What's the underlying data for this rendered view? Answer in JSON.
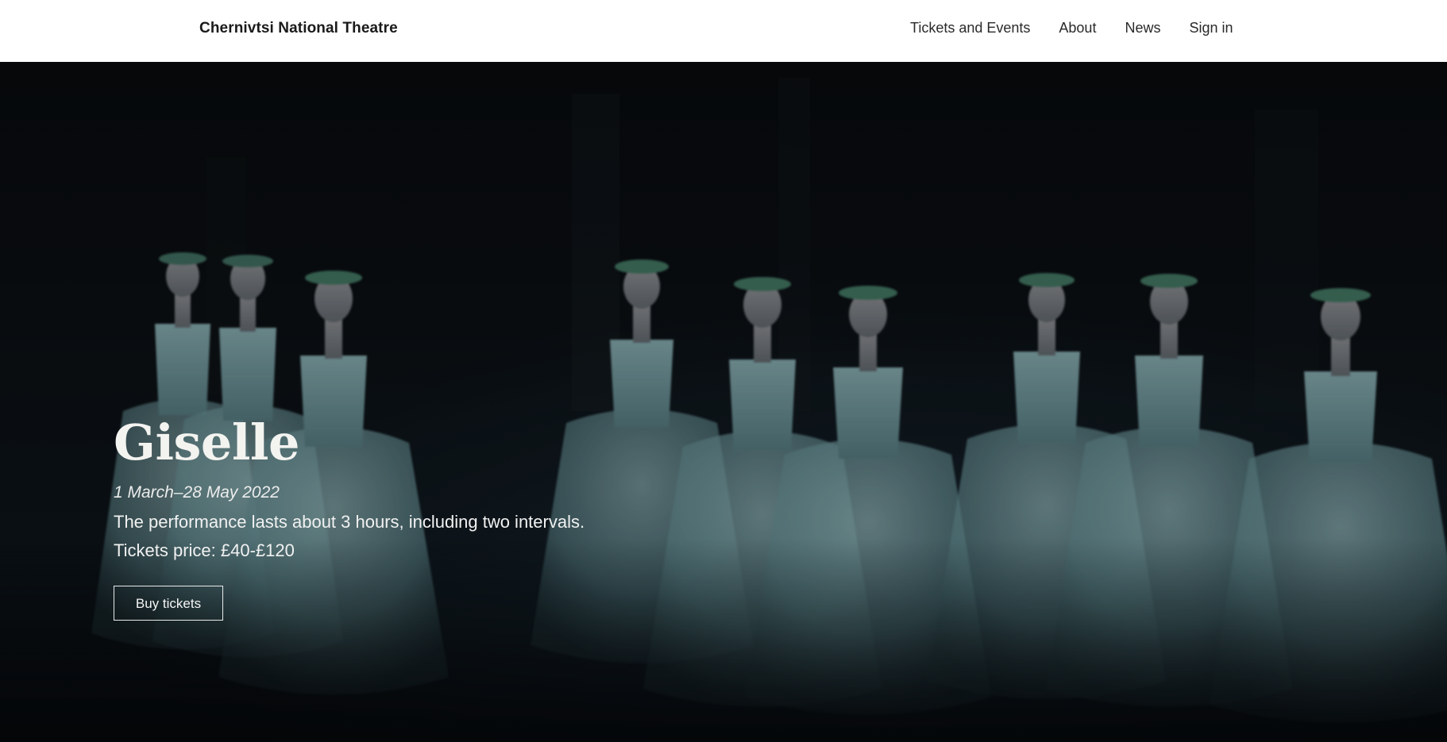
{
  "header": {
    "brand": "Chernivtsi National Theatre",
    "nav": [
      {
        "label": "Tickets and Events"
      },
      {
        "label": "About"
      },
      {
        "label": "News"
      },
      {
        "label": "Sign in"
      }
    ]
  },
  "hero": {
    "title": "Giselle",
    "dates": "1 March–28 May 2022",
    "description": "The performance lasts about 3 hours, including two intervals.",
    "price": "Tickets price: £40-£120",
    "cta_label": "Buy tickets",
    "image_subject": "ballet dancers in pale blue tutus with floral wreaths on a dark stage"
  },
  "colors": {
    "header_bg": "#ffffff",
    "hero_bg": "#0a0e12",
    "dress": "#6f9aa0",
    "text_light": "#f3f3f0"
  }
}
